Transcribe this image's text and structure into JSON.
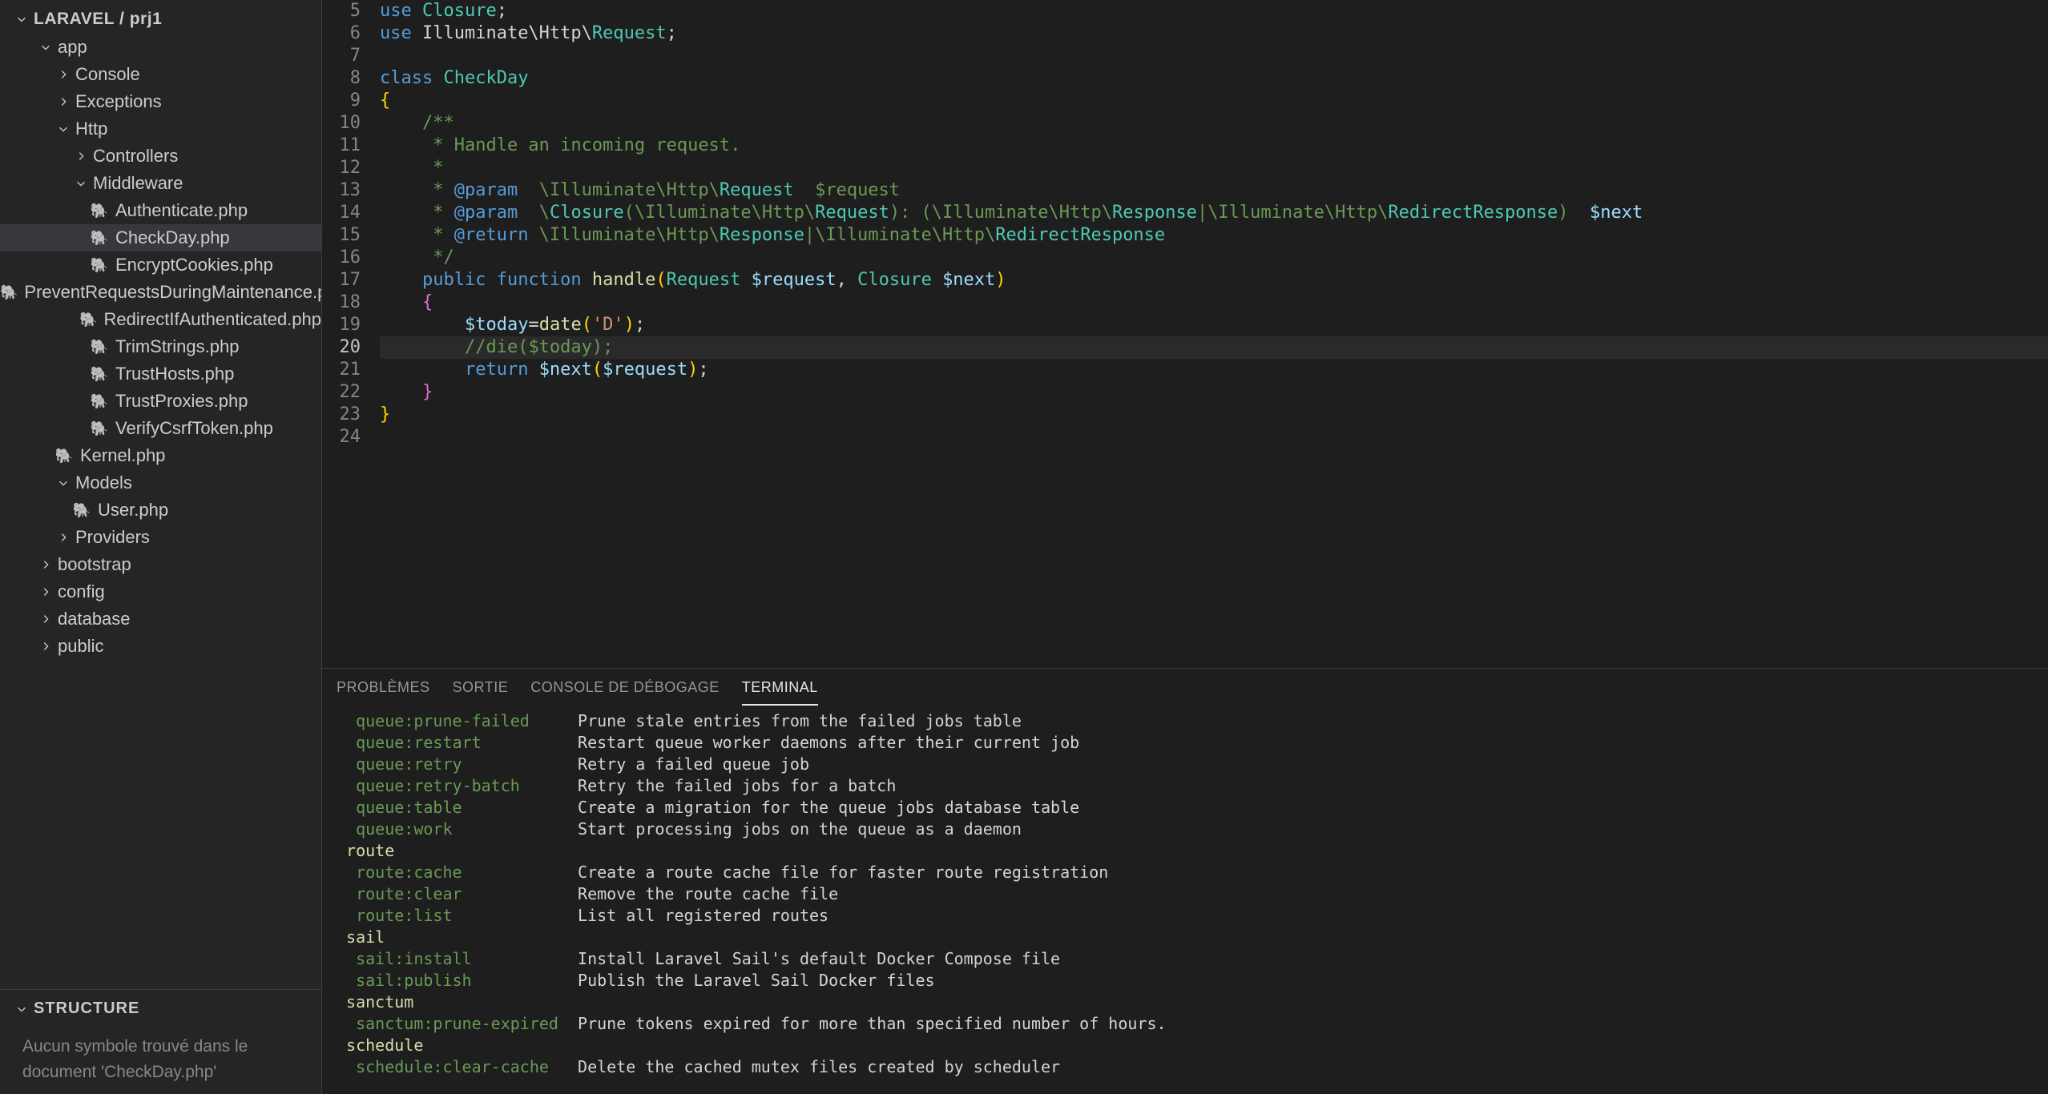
{
  "sidebar": {
    "root_label": "LARAVEL / prj1",
    "tree": [
      {
        "label": "app",
        "type": "folder",
        "depth": 1,
        "open": true
      },
      {
        "label": "Console",
        "type": "folder",
        "depth": 2,
        "open": false
      },
      {
        "label": "Exceptions",
        "type": "folder",
        "depth": 2,
        "open": false
      },
      {
        "label": "Http",
        "type": "folder",
        "depth": 2,
        "open": true
      },
      {
        "label": "Controllers",
        "type": "folder",
        "depth": 3,
        "open": false
      },
      {
        "label": "Middleware",
        "type": "folder",
        "depth": 3,
        "open": true
      },
      {
        "label": "Authenticate.php",
        "type": "php",
        "depth": 4
      },
      {
        "label": "CheckDay.php",
        "type": "php",
        "depth": 4,
        "selected": true
      },
      {
        "label": "EncryptCookies.php",
        "type": "php",
        "depth": 4
      },
      {
        "label": "PreventRequestsDuringMaintenance.php",
        "type": "php",
        "depth": 4
      },
      {
        "label": "RedirectIfAuthenticated.php",
        "type": "php",
        "depth": 4
      },
      {
        "label": "TrimStrings.php",
        "type": "php",
        "depth": 4
      },
      {
        "label": "TrustHosts.php",
        "type": "php",
        "depth": 4
      },
      {
        "label": "TrustProxies.php",
        "type": "php",
        "depth": 4
      },
      {
        "label": "VerifyCsrfToken.php",
        "type": "php",
        "depth": 4
      },
      {
        "label": "Kernel.php",
        "type": "php",
        "depth": 2
      },
      {
        "label": "Models",
        "type": "folder",
        "depth": 2,
        "open": true
      },
      {
        "label": "User.php",
        "type": "php",
        "depth": 3
      },
      {
        "label": "Providers",
        "type": "folder",
        "depth": 2,
        "open": false
      },
      {
        "label": "bootstrap",
        "type": "folder",
        "depth": 1,
        "open": false
      },
      {
        "label": "config",
        "type": "folder",
        "depth": 1,
        "open": false
      },
      {
        "label": "database",
        "type": "folder",
        "depth": 1,
        "open": false
      },
      {
        "label": "public",
        "type": "folder",
        "depth": 1,
        "open": false
      }
    ],
    "structure_label": "STRUCTURE",
    "structure_message": "Aucun symbole trouvé dans le document 'CheckDay.php'"
  },
  "editor": {
    "line_start": 5,
    "line_end": 24,
    "current_line": 20,
    "lines": [
      [
        {
          "t": "use ",
          "c": "keyword"
        },
        {
          "t": "Closure",
          "c": "type"
        },
        {
          "t": ";",
          "c": "punct"
        }
      ],
      [
        {
          "t": "use ",
          "c": "keyword"
        },
        {
          "t": "Illuminate\\Http\\",
          "c": "punct"
        },
        {
          "t": "Request",
          "c": "type"
        },
        {
          "t": ";",
          "c": "punct"
        }
      ],
      [],
      [
        {
          "t": "class ",
          "c": "keyword"
        },
        {
          "t": "CheckDay",
          "c": "class"
        }
      ],
      [
        {
          "t": "{",
          "c": "brace"
        }
      ],
      [
        {
          "t": "    /**",
          "c": "comment"
        }
      ],
      [
        {
          "t": "     * Handle an incoming request.",
          "c": "comment"
        }
      ],
      [
        {
          "t": "     *",
          "c": "comment"
        }
      ],
      [
        {
          "t": "     * ",
          "c": "comment"
        },
        {
          "t": "@param",
          "c": "doctag"
        },
        {
          "t": "  \\Illuminate\\Http\\",
          "c": "comment"
        },
        {
          "t": "Request",
          "c": "type"
        },
        {
          "t": "  $request",
          "c": "comment"
        }
      ],
      [
        {
          "t": "     * ",
          "c": "comment"
        },
        {
          "t": "@param",
          "c": "doctag"
        },
        {
          "t": "  \\",
          "c": "comment"
        },
        {
          "t": "Closure",
          "c": "type"
        },
        {
          "t": "(",
          "c": "comment"
        },
        {
          "t": "\\Illuminate\\Http\\",
          "c": "comment"
        },
        {
          "t": "Request",
          "c": "type"
        },
        {
          "t": "): (",
          "c": "comment"
        },
        {
          "t": "\\Illuminate\\Http\\",
          "c": "comment"
        },
        {
          "t": "Response",
          "c": "type"
        },
        {
          "t": "|",
          "c": "comment"
        },
        {
          "t": "\\Illuminate\\Http\\",
          "c": "comment"
        },
        {
          "t": "RedirectResponse",
          "c": "type"
        },
        {
          "t": ")  ",
          "c": "comment"
        },
        {
          "t": "$next",
          "c": "var"
        }
      ],
      [
        {
          "t": "     * ",
          "c": "comment"
        },
        {
          "t": "@return",
          "c": "doctag"
        },
        {
          "t": " \\Illuminate\\Http\\",
          "c": "comment"
        },
        {
          "t": "Response",
          "c": "type"
        },
        {
          "t": "|",
          "c": "comment"
        },
        {
          "t": "\\Illuminate\\Http\\",
          "c": "comment"
        },
        {
          "t": "RedirectResponse",
          "c": "type"
        }
      ],
      [
        {
          "t": "     */",
          "c": "comment"
        }
      ],
      [
        {
          "t": "    ",
          "c": ""
        },
        {
          "t": "public ",
          "c": "keyword"
        },
        {
          "t": "function ",
          "c": "keyword"
        },
        {
          "t": "handle",
          "c": "function"
        },
        {
          "t": "(",
          "c": "paren1"
        },
        {
          "t": "Request ",
          "c": "type"
        },
        {
          "t": "$request",
          "c": "var"
        },
        {
          "t": ", ",
          "c": "punct"
        },
        {
          "t": "Closure ",
          "c": "type"
        },
        {
          "t": "$next",
          "c": "var"
        },
        {
          "t": ")",
          "c": "paren1"
        }
      ],
      [
        {
          "t": "    ",
          "c": ""
        },
        {
          "t": "{",
          "c": "paren2"
        }
      ],
      [
        {
          "t": "        ",
          "c": ""
        },
        {
          "t": "$today",
          "c": "var"
        },
        {
          "t": "=",
          "c": "punct"
        },
        {
          "t": "date",
          "c": "function"
        },
        {
          "t": "(",
          "c": "paren1"
        },
        {
          "t": "'D'",
          "c": "string"
        },
        {
          "t": ")",
          "c": "paren1"
        },
        {
          "t": ";",
          "c": "punct"
        }
      ],
      [
        {
          "t": "        ",
          "c": ""
        },
        {
          "t": "//die($today);",
          "c": "comment"
        }
      ],
      [
        {
          "t": "        ",
          "c": ""
        },
        {
          "t": "return ",
          "c": "keyword"
        },
        {
          "t": "$next",
          "c": "var"
        },
        {
          "t": "(",
          "c": "paren1"
        },
        {
          "t": "$request",
          "c": "var"
        },
        {
          "t": ")",
          "c": "paren1"
        },
        {
          "t": ";",
          "c": "punct"
        }
      ],
      [
        {
          "t": "    ",
          "c": ""
        },
        {
          "t": "}",
          "c": "paren2"
        }
      ],
      [
        {
          "t": "}",
          "c": "brace"
        }
      ],
      []
    ]
  },
  "panel": {
    "tabs": [
      "PROBLÈMES",
      "SORTIE",
      "CONSOLE DE DÉBOGAGE",
      "TERMINAL"
    ],
    "active_tab": 3,
    "terminal_lines": [
      {
        "cmd": "  queue:prune-failed",
        "desc": "Prune stale entries from the failed jobs table"
      },
      {
        "cmd": "  queue:restart",
        "desc": "Restart queue worker daemons after their current job"
      },
      {
        "cmd": "  queue:retry",
        "desc": "Retry a failed queue job"
      },
      {
        "cmd": "  queue:retry-batch",
        "desc": "Retry the failed jobs for a batch"
      },
      {
        "cmd": "  queue:table",
        "desc": "Create a migration for the queue jobs database table"
      },
      {
        "cmd": "  queue:work",
        "desc": "Start processing jobs on the queue as a daemon"
      },
      {
        "section": " route"
      },
      {
        "cmd": "  route:cache",
        "desc": "Create a route cache file for faster route registration"
      },
      {
        "cmd": "  route:clear",
        "desc": "Remove the route cache file"
      },
      {
        "cmd": "  route:list",
        "desc": "List all registered routes"
      },
      {
        "section": " sail"
      },
      {
        "cmd": "  sail:install",
        "desc": "Install Laravel Sail's default Docker Compose file"
      },
      {
        "cmd": "  sail:publish",
        "desc": "Publish the Laravel Sail Docker files"
      },
      {
        "section": " sanctum"
      },
      {
        "cmd": "  sanctum:prune-expired",
        "desc": "Prune tokens expired for more than specified number of hours."
      },
      {
        "section": " schedule"
      },
      {
        "cmd": "  schedule:clear-cache",
        "desc": "Delete the cached mutex files created by scheduler"
      }
    ],
    "cmd_col_width": 25
  }
}
